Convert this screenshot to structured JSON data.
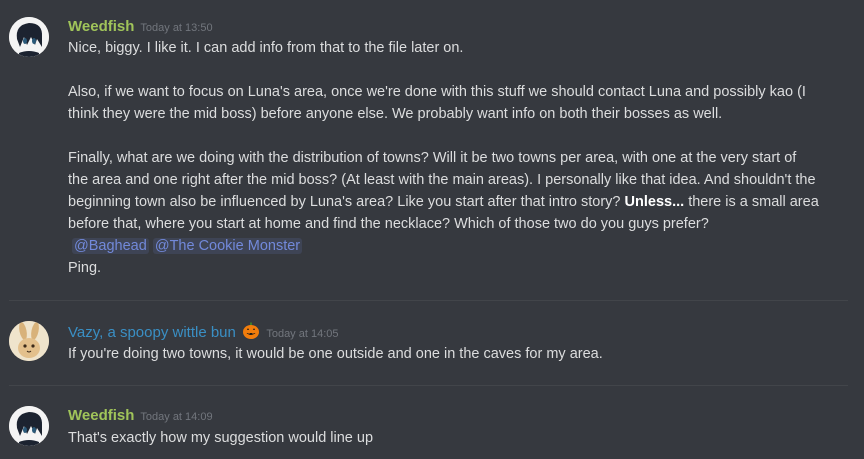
{
  "messages": [
    {
      "author": "Weedfish",
      "timestamp": "Today at 13:50",
      "lines": [
        "Nice, biggy. I like it. I can add info from that to the file later on.",
        "Also, if we want to focus on Luna's area, once we're done with this stuff we should contact Luna and possibly kao (I",
        "think they were the mid boss) before anyone else. We probably want info on both their bosses as well.",
        "Finally, what are we doing with the distribution of towns? Will it be two towns per area, with one at the very start of",
        "the area and one right after the mid boss? (At least with the main areas). I personally like that idea. And shouldn't the",
        "beginning town also be influenced by Luna's area? Like you start after that intro story? ",
        "Unless...",
        " there is a small area",
        "before that, where you start at home and find the necklace? Which of those two do you guys prefer?"
      ],
      "mentions": [
        "@Baghead",
        "@The Cookie Monster"
      ],
      "ping": "Ping."
    },
    {
      "author": "Vazy, a spoopy wittle bun",
      "author_emoji": "jack-o-lantern",
      "timestamp": "Today at 14:05",
      "text": "If you're doing two towns, it would be one outside and one in the caves for my area."
    },
    {
      "author": "Weedfish",
      "timestamp": "Today at 14:09",
      "text": "That's exactly how my suggestion would line up"
    }
  ],
  "colors": {
    "background": "#36393f",
    "weedfish_name": "#a0c45a",
    "vazy_name": "#3a8fc4",
    "mention": "#7289da",
    "timestamp": "#72767d",
    "text": "#dcddde"
  }
}
